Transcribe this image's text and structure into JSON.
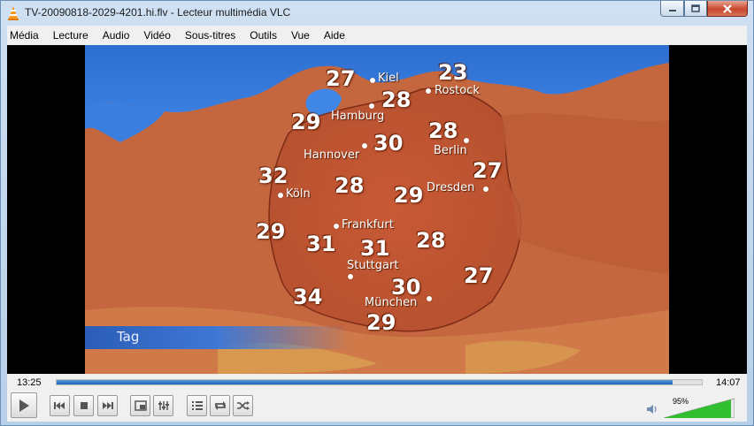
{
  "window": {
    "title": "TV-20090818-2029-4201.hi.flv - Lecteur multimédia VLC"
  },
  "menu": {
    "items": [
      "Média",
      "Lecture",
      "Audio",
      "Vidéo",
      "Sous-titres",
      "Outils",
      "Vue",
      "Aide"
    ]
  },
  "video": {
    "temperatures": [
      "27",
      "23",
      "28",
      "29",
      "30",
      "28",
      "32",
      "27",
      "28",
      "29",
      "29",
      "31",
      "31",
      "28",
      "30",
      "27",
      "34",
      "29"
    ],
    "cities": [
      "Kiel",
      "Rostock",
      "Hamburg",
      "Hannover",
      "Berlin",
      "Köln",
      "Dresden",
      "Frankfurt",
      "Stuttgart",
      "München"
    ],
    "banner_label": "Tag"
  },
  "controls": {
    "elapsed": "13:25",
    "total": "14:07",
    "progress": 0.955,
    "volume_label": "95%",
    "volume": 0.95
  },
  "icons": {
    "play": "play-icon",
    "previous": "previous-icon",
    "stop": "stop-icon",
    "next": "next-icon",
    "fullscreen": "fullscreen-icon",
    "extended": "extended-settings-icon",
    "playlist": "playlist-icon",
    "loop": "loop-icon",
    "random": "shuffle-icon",
    "volume": "speaker-icon"
  },
  "colors": {
    "accent": "#1c63b5",
    "volume_green": "#2fbf2f"
  }
}
